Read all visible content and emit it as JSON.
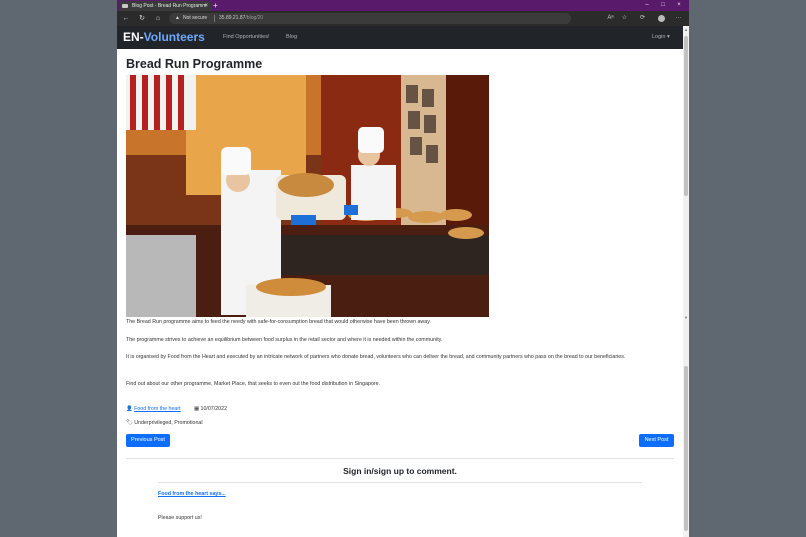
{
  "browser": {
    "tab_title": "Blog Post - Bread Run Programm",
    "tab_close": "×",
    "new_tab": "+",
    "security": "Not secure",
    "url_host": "35.89.21.87",
    "url_path": "/blog/20",
    "min": "–",
    "max": "□",
    "close": "×",
    "menu": "···"
  },
  "site": {
    "brand_part1": "EN-",
    "brand_part2": "Volunteers",
    "nav_find": "Find Opportunities!",
    "nav_blog": "Blog",
    "nav_login": "Login ▾"
  },
  "post": {
    "title": "Bread Run Programme",
    "paragraphs": [
      "The Bread Run programme aims to feed the needy with safe-for-consumption bread that would otherwise have been thrown away.",
      "The programme strives to achieve an equilibrium between food surplus in the retail sector and where it is needed within the community.",
      "It is organised by Food from the Heart and executed by an intricate network of partners who donate bread, volunteers who can deliver the bread, and community partners who pass on the bread to our beneficiaries.",
      "Find out about our other programme, Market Place, that seeks to even out the food distribution in Singapore."
    ],
    "author": "Food from the heart",
    "date": "10/07/2022",
    "tags": "Underprivileged, Promotional",
    "prev_label": "Previous Post",
    "next_label": "Next Post"
  },
  "comments": {
    "heading": "Sign in/sign up to comment.",
    "items": [
      {
        "author": "Food from the heart says...",
        "text": "Please support us!"
      }
    ]
  },
  "colors": {
    "accent": "#0d6efd",
    "brand_highlight": "#6ea8fe",
    "navbar": "#212529",
    "titlebar": "#5a1a6b"
  }
}
